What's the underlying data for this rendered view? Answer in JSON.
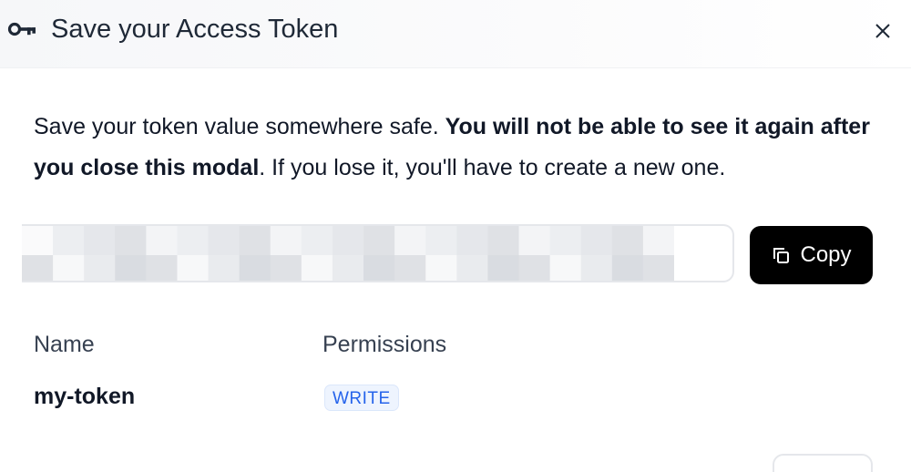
{
  "modal": {
    "title": "Save your Access Token",
    "title_icon": "key-icon",
    "close_icon": "close-icon"
  },
  "warning": {
    "part1": "Save your token value somewhere safe. ",
    "bold": "You will not be able to see it again after you close this modal",
    "part2": ". If you lose it, you'll have to create a new one."
  },
  "token": {
    "value_obscured": true,
    "copy_label": "Copy",
    "copy_icon": "copy-icon"
  },
  "details": {
    "name_label": "Name",
    "permissions_label": "Permissions",
    "name_value": "my-token",
    "permission_value": "WRITE"
  },
  "colors": {
    "copy_button_bg": "#000000",
    "badge_text": "#2563eb",
    "badge_bg": "#eef4fe"
  }
}
